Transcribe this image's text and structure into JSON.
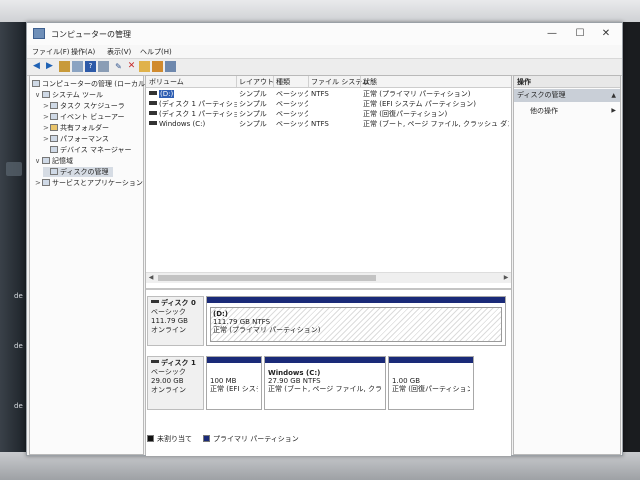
{
  "window": {
    "title": "コンピューターの管理",
    "controls": {
      "minimize": "—",
      "maximize": "☐",
      "close": "✕"
    }
  },
  "menu": [
    "ファイル(F)",
    "操作(A)",
    "表示(V)",
    "ヘルプ(H)"
  ],
  "toolbar": {
    "back_icon": "arrow-left-icon",
    "forward_icon": "arrow-right-icon",
    "delete_glyph": "✕"
  },
  "tree": [
    {
      "label": "コンピューターの管理 (ローカル)",
      "level": 0,
      "expander": "",
      "icon": "computer-icon"
    },
    {
      "label": "システム ツール",
      "level": 1,
      "expander": "∨",
      "icon": "tools-icon"
    },
    {
      "label": "タスク スケジューラ",
      "level": 2,
      "expander": ">",
      "icon": "clock-icon"
    },
    {
      "label": "イベント ビューアー",
      "level": 2,
      "expander": ">",
      "icon": "event-icon"
    },
    {
      "label": "共有フォルダー",
      "level": 2,
      "expander": ">",
      "icon": "folder-icon"
    },
    {
      "label": "パフォーマンス",
      "level": 2,
      "expander": ">",
      "icon": "performance-icon"
    },
    {
      "label": "デバイス マネージャー",
      "level": 2,
      "expander": "",
      "icon": "device-icon"
    },
    {
      "label": "記憶域",
      "level": 1,
      "expander": "∨",
      "icon": "storage-icon"
    },
    {
      "label": "ディスクの管理",
      "level": 2,
      "expander": "",
      "icon": "disk-icon",
      "selected": true
    },
    {
      "label": "サービスとアプリケーション",
      "level": 1,
      "expander": ">",
      "icon": "services-icon"
    }
  ],
  "volume_list": {
    "headers": [
      "ボリューム",
      "レイアウト",
      "種類",
      "ファイル システム",
      "状態"
    ],
    "rows": [
      {
        "volume": "(D:)",
        "layout": "シンプル",
        "type": "ベーシック",
        "fs": "NTFS",
        "status": "正常 (プライマリ パーティション)",
        "selected": true
      },
      {
        "volume": "(ディスク 1 パーティション 1)",
        "layout": "シンプル",
        "type": "ベーシック",
        "fs": "",
        "status": "正常 (EFI システム パーティション)"
      },
      {
        "volume": "(ディスク 1 パーティション 4)",
        "layout": "シンプル",
        "type": "ベーシック",
        "fs": "",
        "status": "正常 (回復パーティション)"
      },
      {
        "volume": "Windows (C:)",
        "layout": "シンプル",
        "type": "ベーシック",
        "fs": "NTFS",
        "status": "正常 (ブート, ページ ファイル, クラッシュ ダンプ, ベーシ"
      }
    ]
  },
  "disks": [
    {
      "name": "ディスク 0",
      "type": "ベーシック",
      "size": "111.79 GB",
      "state": "オンライン",
      "partitions": [
        {
          "name": "(D:)",
          "size": "111.79 GB NTFS",
          "status": "正常 (プライマリ パーティション)",
          "hatched": true
        }
      ]
    },
    {
      "name": "ディスク 1",
      "type": "ベーシック",
      "size": "29.00 GB",
      "state": "オンライン",
      "partitions": [
        {
          "name": "",
          "size": "100 MB",
          "status": "正常 (EFI システ"
        },
        {
          "name": "Windows (C:)",
          "size": "27.90 GB NTFS",
          "status": "正常 (ブート, ページ ファイル, クラッシュ ダ"
        },
        {
          "name": "",
          "size": "1.00 GB",
          "status": "正常 (回復パーティション)"
        }
      ]
    }
  ],
  "legend": [
    {
      "label": "未割り当て",
      "color": "#111111"
    },
    {
      "label": "プライマリ パーティション",
      "color": "#1a2a78"
    }
  ],
  "actions": {
    "header": "操作",
    "subheader": "ディスクの管理",
    "item": "他の操作"
  },
  "desktop_labels": [
    "de",
    "de",
    "de"
  ]
}
